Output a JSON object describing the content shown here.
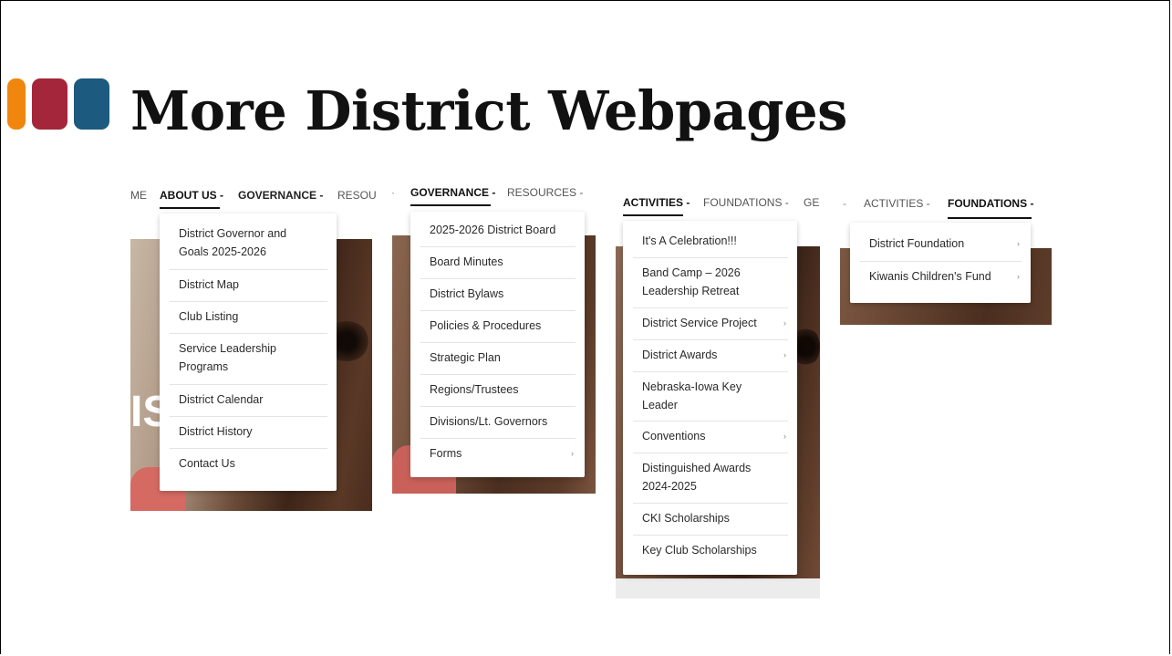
{
  "slide": {
    "title": "More District Webpages",
    "accent_colors": [
      "#f0860e",
      "#a3263a",
      "#1c5a80"
    ]
  },
  "panel1": {
    "nav": [
      "ME",
      "ABOUT US -",
      "GOVERNANCE -",
      "RESOU"
    ],
    "items": [
      "District Governor and Goals 2025-2026",
      "District Map",
      "Club Listing",
      "Service Leadership Programs",
      "District Calendar",
      "District History",
      "Contact Us"
    ]
  },
  "panel2": {
    "nav": [
      "GOVERNANCE -",
      "RESOURCES -"
    ],
    "items": [
      "2025-2026 District Board",
      "Board Minutes",
      "District Bylaws",
      "Policies & Procedures",
      "Strategic Plan",
      "Regions/Trustees",
      "Divisions/Lt. Governors",
      "Forms"
    ]
  },
  "panel3": {
    "nav": [
      "ACTIVITIES -",
      "FOUNDATIONS -",
      "GE"
    ],
    "items": [
      "It's A Celebration!!!",
      "Band Camp – 2026 Leadership Retreat",
      "District Service Project",
      "District Awards",
      "Nebraska-Iowa Key Leader",
      "Conventions",
      "Distinguished Awards 2024-2025",
      "CKI Scholarships",
      "Key Club Scholarships"
    ]
  },
  "panel4": {
    "nav": [
      "ACTIVITIES -",
      "FOUNDATIONS -"
    ],
    "items": [
      "District Foundation",
      "Kiwanis Children's Fund"
    ]
  }
}
